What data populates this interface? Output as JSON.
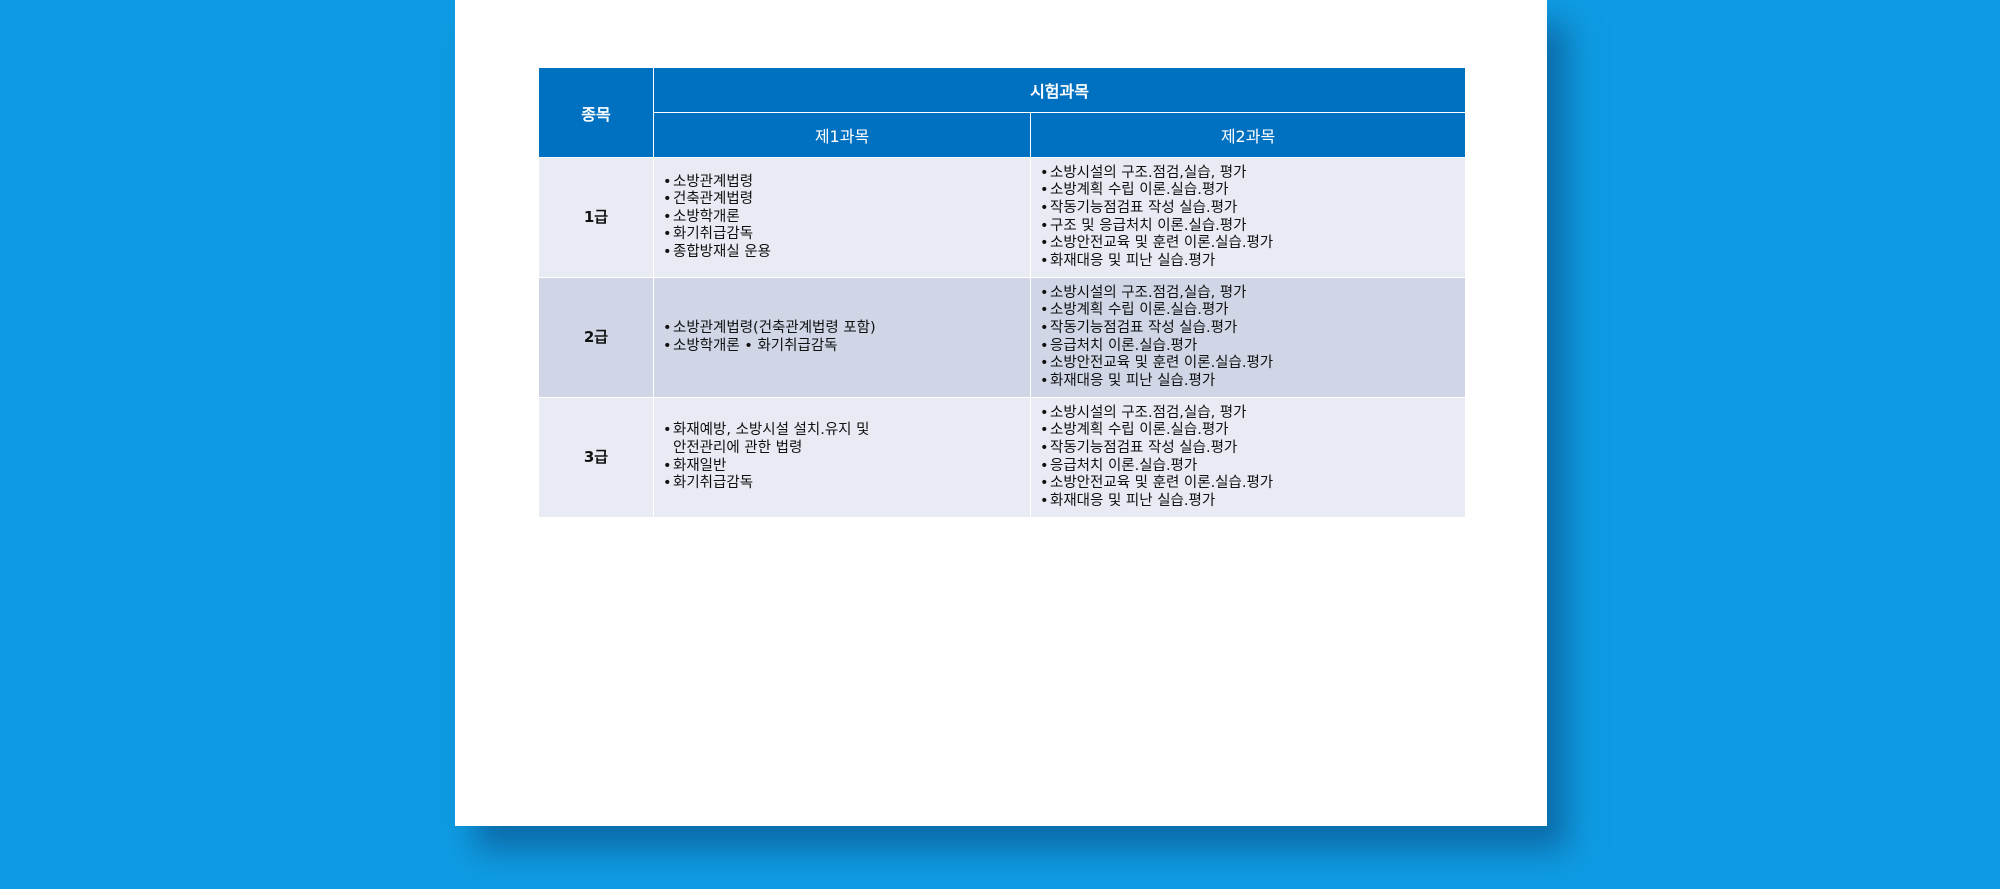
{
  "table": {
    "header": {
      "kind": "종목",
      "subjects": "시험과목",
      "subject1": "제1과목",
      "subject2": "제2과목"
    },
    "rows": [
      {
        "grade": "1급",
        "subject1": [
          "소방관계법령",
          "건축관계법령",
          "소방학개론",
          "화기취급감독",
          "종합방재실 운용"
        ],
        "subject2": [
          "소방시설의 구조.점검,실습, 평가",
          "소방계획 수립 이론.실습.평가",
          "작동기능점검표 작성 실습.평가",
          "구조 및 응급처치 이론.실습.평가",
          "소방안전교육 및 훈련 이론.실습.평가",
          "화재대응 및 피난 실습.평가"
        ]
      },
      {
        "grade": "2급",
        "subject1": [
          "소방관계법령(건축관계법령 포함)",
          "소방학개론 • 화기취급감독"
        ],
        "subject2": [
          "소방시설의 구조.점검,실습, 평가",
          "소방계획 수립 이론.실습.평가",
          "작동기능점검표 작성 실습.평가",
          "응급처치 이론.실습.평가",
          "소방안전교육 및 훈련 이론.실습.평가",
          "화재대응 및 피난 실습.평가"
        ]
      },
      {
        "grade": "3급",
        "subject1": [
          "화재예방, 소방시설 설치.유지 및\n안전관리에 관한 법령",
          "화재일반",
          "화기취급감독"
        ],
        "subject2": [
          "소방시설의 구조.점검,실습, 평가",
          "소방계획 수립 이론.실습.평가",
          "작동기능점검표 작성 실습.평가",
          "응급처치 이론.실습.평가",
          "소방안전교육 및 훈련 이론.실습.평가",
          "화재대응 및 피난 실습.평가"
        ]
      }
    ]
  },
  "colors": {
    "background": "#0f9be3",
    "header": "#0070c0",
    "row_light": "#e8ebf3",
    "row_dark": "#d0d6e6"
  }
}
